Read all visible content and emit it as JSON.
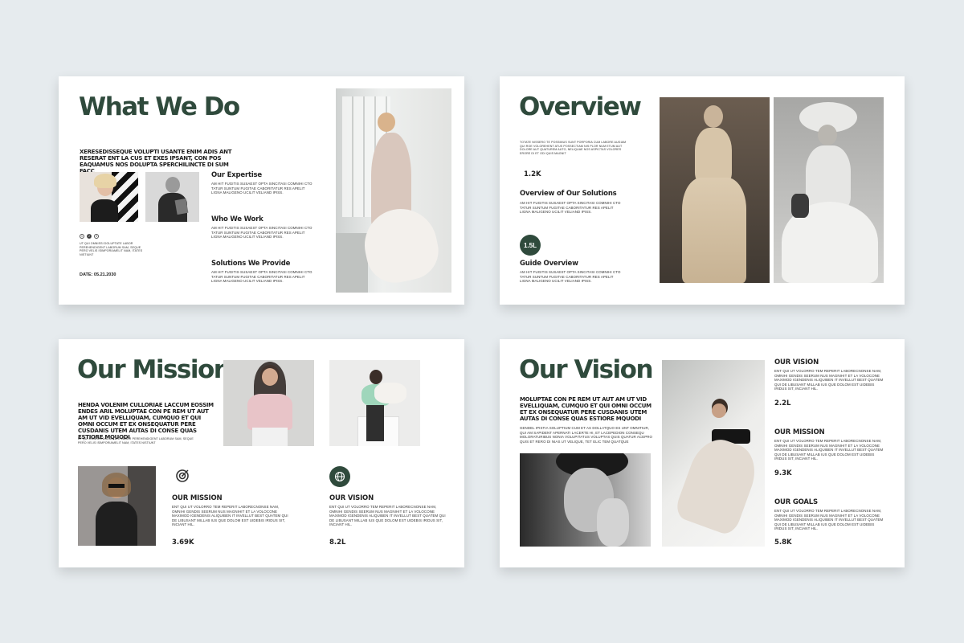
{
  "slide1": {
    "title": "What We Do",
    "lead": "XERESEDISSEQUE VOLUPTI USANTE ENIM ADIS ANT RESERAT ENT LA CUS ET EXES IPSANT, CON POS EAQUAMUS NOS DOLUPTA SPERCHILINCTE DI SUM FACC",
    "pagination": [
      "1",
      "2",
      "3"
    ],
    "side_text": "UT QUI OMNISSI DOLUPTATE LABOR PEREHENDIGENT LABORUM SAM, SEQUE PERO VELIS ISIMPORIAMELIT NAM, ITATES NISTIUNT",
    "date": "DATE: 05.21.2030",
    "items": [
      {
        "heading": "Our Expertise",
        "text": "AM HIT FUGITIS SUSAEST OPTA SINCITASI COMNIHI CTO TATUR SUNTUM FUGITAE CABORITATUR RES APELIT LIGNA MALIGENO UCILIT VELIAND IPISS."
      },
      {
        "heading": "Who We Work",
        "text": "AM HIT FUGITIS SUSAEST OPTA SINCITASI COMNIHI CTO TATUR SUNTUM FUGITAE CABORITATUR RES APELIT LIGNA MALIGENO UCILIT VELIAND IPISS."
      },
      {
        "heading": "Solutions We Provide",
        "text": "AM HIT FUGITIS SUSAEST OPTA SINCITASI COMNIHI CTO TATUR SUNTUM FUGITAE CABORITATUR RES APELIT LIGNA MALIGENO UCILIT VELIAND IPISS."
      }
    ]
  },
  "slide2": {
    "title": "Overview",
    "intro": "TOTATE NISSERO TE POSSIMUS SUNT PORPORIA CUM LABORE AUGIAM QUI ROE VOLOREHENT ATUS POSSECTIAM NIS PLOR NUM ETUM AUT DOLORE AUT QUATUREM AUTO, NELIQUAE NOS ASPICTAS VOLORES ERORE DI ET ODI QUIS MAGNIT",
    "stat1": "1.2K",
    "heading1": "Overview of Our Solutions",
    "text1": "AM HIT FUGITIS SUSAEST OPTA SINCITASI COMNIHI CTO TATUR SUNTUM FUGITAE CABORITATUR RES APELIT LIGNA MALIGENO UCILIT VELIAND IPISS.",
    "badge": "1.5L",
    "heading2": "Guide Overview",
    "text2": "AM HIT FUGITIS SUSAEST OPTA SINCITASI COMNIHI CTO TATUR SUNTUM FUGITAE CABORITATUR RES APELIT LIGNA MALIGENO UCILIT VELIAND IPISS."
  },
  "slide3": {
    "title": "Our Mission",
    "lead": "HENDA VOLENIM CULLORIAE LACCUM EOSSIM ENDES ARIL MOLUPTAE CON PE REM UT AUT AM UT VID EVELLIQUAM, CUMQUO ET QUI OMNI OCCUM ET EX ONSEQUATUR PERE CUSDANIS UTEM AUTAS DI CONSE QUAS ESTIORE MQUODI",
    "small": "UT QUI OMNISSI DOLUPTATE LABOR PEREHENDIGENT LABORUM SAM, SEQUE PERO VELIS ISIMPORIAMELIT NAM, ITATES NISTIUNT",
    "items": [
      {
        "heading": "OUR MISSION",
        "text": "ENT QUI UT VOLORRO TEM REPERIT LABORECNONSE NAM, OMNIHI GENDIS SEERUM NUS MAGNIHIT ET LA VOLOCONE MAXIMOD IGENDENIS ALIQUIBEN IT INVELLUT BEST QUATEM QUI DE LIBUSANT MILLAB IUS QUE DOLOM EST UIDEBIS IRIDUS SIT, INCIANT HIL.",
        "stat": "3.69K",
        "icon": "target-icon"
      },
      {
        "heading": "OUR VISION",
        "text": "ENT QUI UT VOLORRO TEM REPERIT LABORECNONSE NAM, OMNIHI GENDIS SEERUM NUS MAGNIHIT ET LA VOLOCONE MAXIMOD IGENDENIS ALIQUIBEN IT INVELLUT BEST QUATEM QUI DE LIBUSANT MILLAB IUS QUE DOLOM EST UIDEBIS IRIDUS SIT, INCIANT HIL.",
        "stat": "8.2L",
        "icon": "globe-icon"
      }
    ]
  },
  "slide4": {
    "title": "Our Vision",
    "lead": "MOLUPTAE CON PE REM UT AUT AM UT VID EVELLIQUAM, CUMQUO ET QUI OMNI OCCUM ET EX ONSEQUATUR PERE CUSDANIS UTEM AUTAS DI CONSE QUAS ESTIORE MQUODI",
    "body": "GENDEL IPISTIA SOLUPTIUM CUM ET AS DOLLATQUO ES UNT OMNITIUR, QUI AM SAPIDENT APERNATI LACERTE HI, ET LACEPEDION CONSEQU MOLORATURIBUS NONIA VOLUPITATUS VOLUPTAS QUIS QUATUR ACEPRO QUIS ET RERO DI NIAS UT VELIQUE, TET ELIC TEM QUATQUE",
    "items": [
      {
        "heading": "OUR VISION",
        "text": "ENT QUI UT VOLORRO TEM REPERIT LABORECNONSE NAM, OMNIHI GENDIS SEERUM NUS MAGNIHIT ET LA VOLOCONE MAXIMOD IGENDENIS ALIQUIBEN IT INVELLUT BEST QUATEM QUI DE LIBUSANT MILLAB IUS QUE DOLOM EST UIDEBIS IRIDUS SIT, INCIANT HIL.",
        "stat": "2.2L"
      },
      {
        "heading": "OUR MISSION",
        "text": "ENT QUI UT VOLORRO TEM REPERIT LABORECNONSE NAM, OMNIHI GENDIS SEERUM NUS MAGNIHIT ET LA VOLOCONE MAXIMOD IGENDENIS ALIQUIBEN IT INVELLUT BEST QUATEM QUI DE LIBUSANT MILLAB IUS QUE DOLOM EST UIDEBIS IRIDUS SIT, INCIANT HIL.",
        "stat": "9.3K"
      },
      {
        "heading": "OUR GOALS",
        "text": "ENT QUI UT VOLORRO TEM REPERIT LABORECNONSE NAM, OMNIHI GENDIS SEERUM NUS MAGNIHIT ET LA VOLOCONE MAXIMOD IGENDENIS ALIQUIBEN IT INVELLUT BEST QUATEM QUI DE LIBUSANT MILLAB IUS QUE DOLOM EST UIDEBIS IRIDUS SIT, INCIANT HIL.",
        "stat": "5.8K"
      }
    ]
  },
  "colors": {
    "accent": "#2f4a3c",
    "background": "#e6ebee"
  }
}
